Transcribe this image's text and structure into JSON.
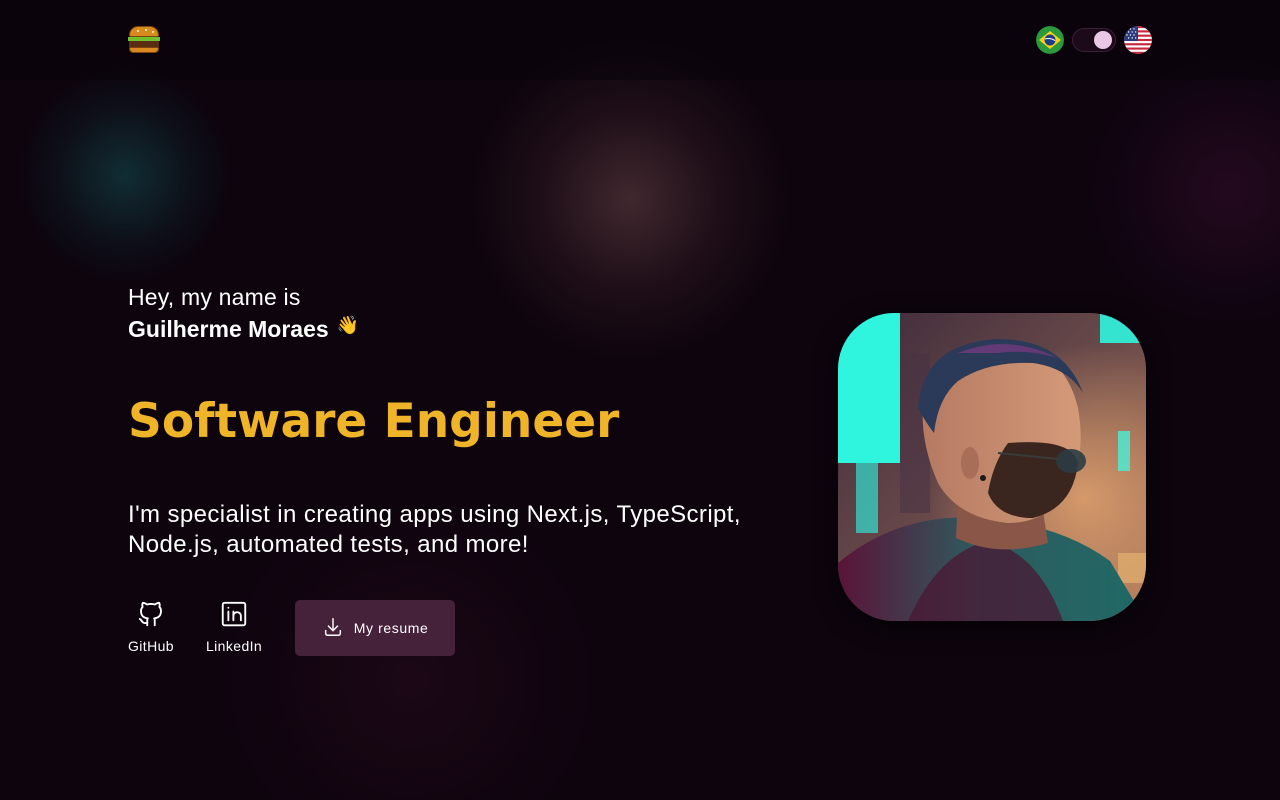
{
  "header": {
    "logo_icon": "hamburger-logo-icon",
    "languages": [
      {
        "code": "pt-BR",
        "icon": "brazil-flag-icon"
      },
      {
        "code": "en-US",
        "icon": "us-flag-icon"
      }
    ],
    "theme_toggle": {
      "icon": "theme-toggle",
      "state": "dark"
    }
  },
  "hero": {
    "greeting": "Hey, my name is",
    "name": "Guilherme Moraes",
    "wave": "👋",
    "role": "Software Engineer",
    "description": "I'm specialist in creating apps using Next.js, TypeScript, Node.js, automated tests, and more!",
    "links": [
      {
        "label": "GitHub",
        "icon": "github-icon"
      },
      {
        "label": "LinkedIn",
        "icon": "linkedin-icon"
      }
    ],
    "resume_button": {
      "label": "My resume",
      "icon": "download-icon"
    }
  },
  "portrait": {
    "icon": "profile-portrait"
  },
  "colors": {
    "background": "#0d040e",
    "accent": "#f0b429",
    "button": "#45213a"
  }
}
